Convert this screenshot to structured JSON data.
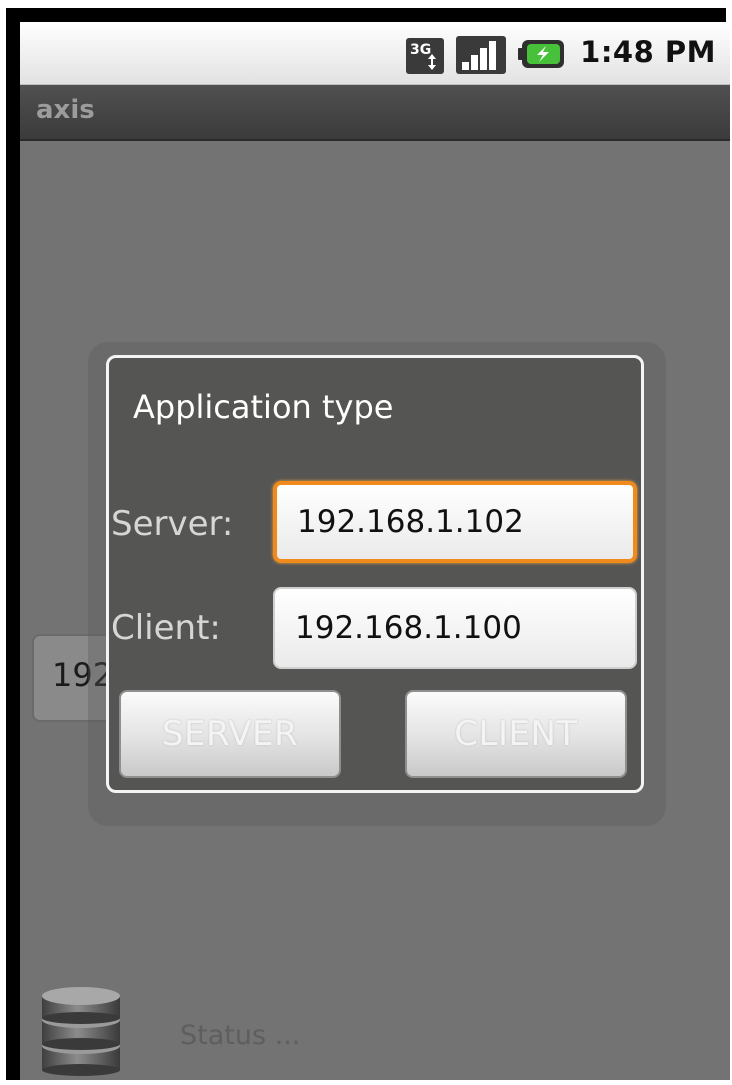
{
  "status_bar": {
    "network_badge": "3G",
    "network_icon": "network-3g-icon",
    "signal_icon": "signal-strength-icon",
    "battery_icon": "battery-charging-icon",
    "time": "1:48 PM"
  },
  "app": {
    "title": "axis"
  },
  "background": {
    "ip_field_value": "192.168.1.100",
    "status_text": "Status ...",
    "db_icon": "database-icon"
  },
  "dialog": {
    "title": "Application type",
    "server_label": "Server:",
    "server_value": "192.168.1.102",
    "client_label": "Client:",
    "client_value": "192.168.1.100",
    "server_button": "SERVER",
    "client_button": "CLIENT"
  },
  "colors": {
    "focus_accent": "#f08a1c",
    "dialog_bg": "#555653",
    "screen_bg": "#737373"
  }
}
